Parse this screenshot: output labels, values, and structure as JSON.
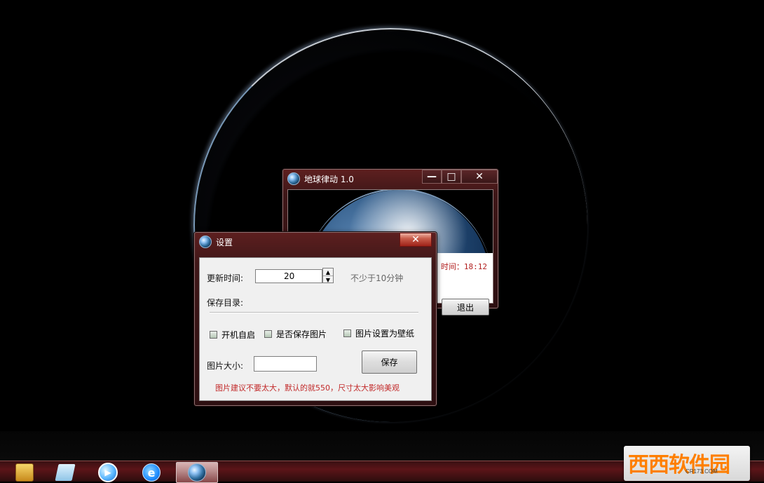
{
  "main_window": {
    "title": "地球律动 1.0",
    "update_time_text": "时间：18:12",
    "exit_label": "退出"
  },
  "settings_window": {
    "title": "设置",
    "update_time_label": "更新时间:",
    "update_time_value": "20",
    "hint": "不少于10分钟",
    "save_dir_label": "保存目录:",
    "checkboxes": [
      {
        "label": "开机自启",
        "checked": false
      },
      {
        "label": "是否保存图片",
        "checked": false
      },
      {
        "label": "图片设置为壁纸",
        "checked": false
      }
    ],
    "image_size_label": "图片大小:",
    "image_size_value": "",
    "save_label": "保存",
    "note": "图片建议不要太大，默认的就550，尺寸太大影响美观"
  },
  "window_controls": {
    "minimize": "—",
    "maximize": "□",
    "close": "✕"
  },
  "taskbar": {
    "items": [
      {
        "name": "windows-explorer-icon",
        "active": false
      },
      {
        "name": "notepad-icon",
        "active": false
      },
      {
        "name": "video-player-icon",
        "active": false
      },
      {
        "name": "internet-explorer-icon",
        "active": false
      },
      {
        "name": "earth-app-icon",
        "active": true
      }
    ]
  },
  "watermark": {
    "main_text": "西西软件园",
    "sub_text": "CR173.COM"
  },
  "colors": {
    "window_frame": "#5d1f1f",
    "close_button": "#c85e4c",
    "note_text": "#c22a2a",
    "watermark_orange": "#ff7f00"
  }
}
